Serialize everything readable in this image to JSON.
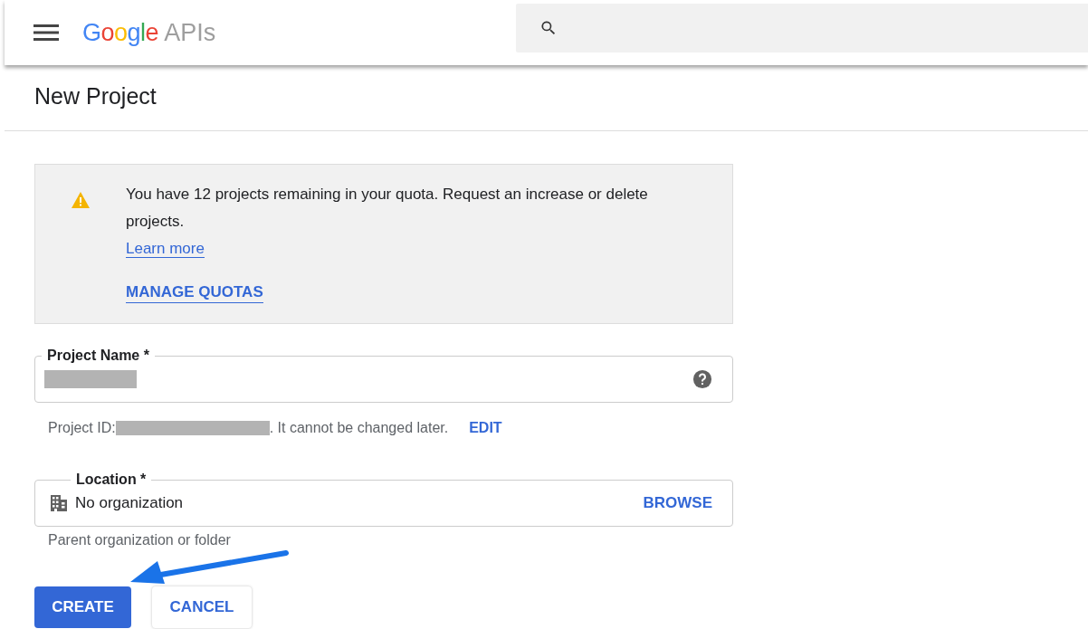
{
  "header": {
    "logo": "Google",
    "product": "APIs"
  },
  "page_title": "New Project",
  "notice": {
    "message": "You have 12 projects remaining in your quota. Request an increase or delete projects.",
    "link": "Learn more",
    "action": "MANAGE QUOTAS"
  },
  "fields": [
    {
      "kind": "redacted-text",
      "label": "Project Name *",
      "hint_prefix": "Project ID:",
      "hint_suffix": ". It cannot be changed later.",
      "hint_action": "EDIT"
    },
    {
      "kind": "picker",
      "label": "Location *",
      "value": "No organization",
      "action": "BROWSE",
      "helper": "Parent organization or folder"
    }
  ],
  "buttons": [
    {
      "kind": "primary",
      "label": "CREATE"
    },
    {
      "kind": "secondary",
      "label": "CANCEL"
    }
  ]
}
